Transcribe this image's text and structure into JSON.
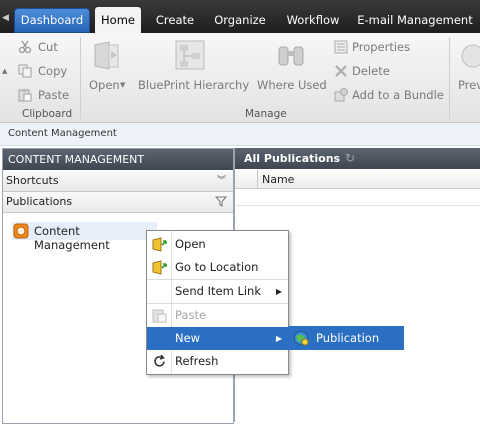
{
  "tabs": {
    "dashboard": "Dashboard",
    "home": "Home",
    "create": "Create",
    "organize": "Organize",
    "workflow": "Workflow",
    "email": "E-mail Management"
  },
  "ribbon": {
    "cut": "Cut",
    "copy": "Copy",
    "paste": "Paste",
    "clipboard_group": "Clipboard",
    "open": "Open",
    "blueprint": "BluePrint Hierarchy",
    "where_used": "Where Used",
    "properties": "Properties",
    "delete": "Delete",
    "add_bundle": "Add to a Bundle",
    "manage_group": "Manage",
    "preview_partial": "Prev"
  },
  "breadcrumb": "Content Management",
  "left_panel": {
    "title": "CONTENT MANAGEMENT",
    "shortcuts": "Shortcuts",
    "publications": "Publications",
    "tree_item": "Content Management"
  },
  "right_panel": {
    "title": "All Publications",
    "column_name": "Name"
  },
  "context_menu": {
    "open": "Open",
    "goto": "Go to Location",
    "send_link": "Send Item Link",
    "paste": "Paste",
    "new": "New",
    "refresh": "Refresh"
  },
  "submenu": {
    "publication": "Publication"
  },
  "colors": {
    "accent": "#2b6fc2",
    "tabbar": "#2a2a2a",
    "panel_header": "#4a525d"
  }
}
